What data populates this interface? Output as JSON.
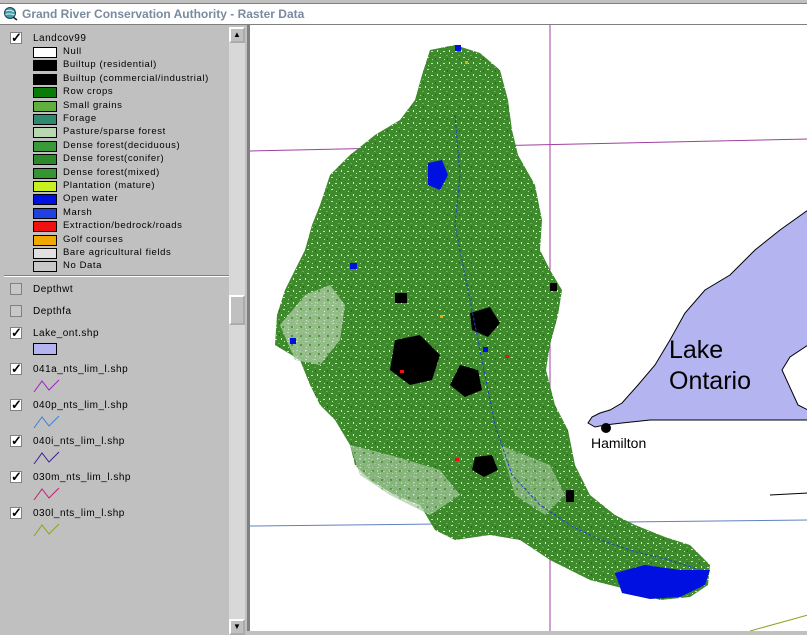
{
  "window": {
    "title": "Grand River Conservation Authority - Raster Data"
  },
  "toc": {
    "landcover": {
      "name": "Landcov99",
      "checked": true,
      "classes": [
        {
          "label": "Null",
          "color": "#ffffff"
        },
        {
          "label": "Builtup (residential)",
          "color": "#000000"
        },
        {
          "label": "Builtup (commercial/industrial)",
          "color": "#000000"
        },
        {
          "label": "Row crops",
          "color": "#0a7a0a"
        },
        {
          "label": "Small grains",
          "color": "#60b040"
        },
        {
          "label": "Forage",
          "color": "#2e8a6e"
        },
        {
          "label": "Pasture/sparse forest",
          "color": "#b8d8b0"
        },
        {
          "label": "Dense forest(deciduous)",
          "color": "#3a9a3a"
        },
        {
          "label": "Dense forest(conifer)",
          "color": "#2a8a2a"
        },
        {
          "label": "Dense forest(mixed)",
          "color": "#339633"
        },
        {
          "label": "Plantation (mature)",
          "color": "#c8f020"
        },
        {
          "label": "Open water",
          "color": "#0010e0"
        },
        {
          "label": "Marsh",
          "color": "#2040e0"
        },
        {
          "label": "Extraction/bedrock/roads",
          "color": "#f01010"
        },
        {
          "label": "Golf courses",
          "color": "#f0a800"
        },
        {
          "label": "Bare agricultural fields",
          "color": "#e0e0e0"
        },
        {
          "label": "No Data",
          "color": "#c8c8c8"
        }
      ]
    },
    "layers": [
      {
        "name": "Depthwt",
        "checked": false
      },
      {
        "name": "Depthfa",
        "checked": false
      },
      {
        "name": "Lake_ont.shp",
        "checked": true,
        "symbol": "fill",
        "color": "#b4b4f0"
      },
      {
        "name": "041a_nts_lim_l.shp",
        "checked": true,
        "symbol": "line",
        "color": "#a020c0"
      },
      {
        "name": "040p_nts_lim_l.shp",
        "checked": true,
        "symbol": "line",
        "color": "#4080d0"
      },
      {
        "name": "040i_nts_lim_l.shp",
        "checked": true,
        "symbol": "line",
        "color": "#402090"
      },
      {
        "name": "030m_nts_lim_l.shp",
        "checked": true,
        "symbol": "line",
        "color": "#c02070"
      },
      {
        "name": "030l_nts_lim_l.shp",
        "checked": true,
        "symbol": "line",
        "color": "#90a020"
      }
    ]
  },
  "map": {
    "lake_label_line1": "Lake",
    "lake_label_line2": "Ontario",
    "city_label": "Hamilton",
    "lake_color": "#b4b4f0",
    "watershed_color": "#3f8a2c",
    "grid_purple": "#a040a0",
    "grid_blue": "#6080c0"
  }
}
